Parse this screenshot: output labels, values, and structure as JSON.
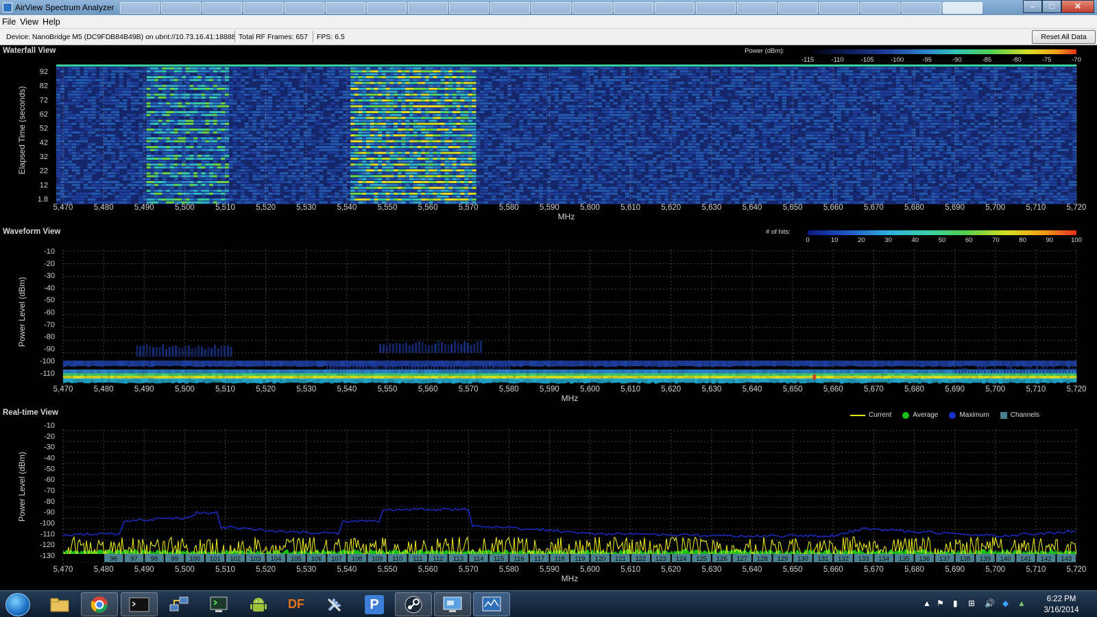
{
  "window": {
    "title": "AirView Spectrum Analyzer",
    "controls": {
      "minimize": "–",
      "maximize": "□",
      "close": "✕"
    }
  },
  "menu": [
    "File",
    "View",
    "Help"
  ],
  "status": {
    "device": "Device: NanoBridge M5 (DC9FDB84B49B) on ubnt://10.73.16.41:18888",
    "frames": "Total RF Frames: 657",
    "fps": "FPS: 6.5",
    "reset_label": "Reset All Data"
  },
  "x_axis": {
    "label": "MHz",
    "ticks": [
      "5,470",
      "5,480",
      "5,490",
      "5,500",
      "5,510",
      "5,520",
      "5,530",
      "5,540",
      "5,550",
      "5,560",
      "5,570",
      "5,580",
      "5,590",
      "5,600",
      "5,610",
      "5,620",
      "5,630",
      "5,640",
      "5,650",
      "5,660",
      "5,670",
      "5,680",
      "5,690",
      "5,700",
      "5,710",
      "5,720"
    ]
  },
  "waterfall": {
    "title": "Waterfall View",
    "ylabel": "Elapsed Time (seconds)",
    "yticks": [
      "92",
      "82",
      "72",
      "62",
      "52",
      "42",
      "32",
      "22",
      "12",
      "1.8"
    ],
    "legend_caption": "Power (dBm):",
    "legend_ticks": [
      "-115",
      "-110",
      "-105",
      "-100",
      "-95",
      "-90",
      "-85",
      "-80",
      "-75",
      "-70"
    ]
  },
  "waveform": {
    "title": "Waveform View",
    "ylabel": "Power Level (dBm)",
    "yticks": [
      "-10",
      "-20",
      "-30",
      "-40",
      "-50",
      "-60",
      "-70",
      "-80",
      "-90",
      "-100",
      "-110"
    ],
    "legend_caption": "# of hits:",
    "legend_ticks": [
      "0",
      "10",
      "20",
      "30",
      "40",
      "50",
      "60",
      "70",
      "80",
      "90",
      "100"
    ]
  },
  "realtime": {
    "title": "Real-time View",
    "ylabel": "Power Level (dBm)",
    "yticks": [
      "-10",
      "-20",
      "-30",
      "-40",
      "-50",
      "-60",
      "-70",
      "-80",
      "-90",
      "-100",
      "-110",
      "-120",
      "-130"
    ],
    "legend": [
      {
        "label": "Current",
        "color": "#e6e61e"
      },
      {
        "label": "Average",
        "color": "#18c018"
      },
      {
        "label": "Maximum",
        "color": "#1a2fd0"
      },
      {
        "label": "Channels",
        "color": "#4a7f8f"
      }
    ],
    "channels": [
      "96",
      "97",
      "98",
      "99",
      "100",
      "101",
      "102",
      "103",
      "104",
      "105",
      "106",
      "107",
      "108",
      "109",
      "110",
      "111",
      "112",
      "113",
      "114",
      "115",
      "116",
      "117",
      "118",
      "119",
      "120",
      "121",
      "122",
      "123",
      "124",
      "125",
      "126",
      "127",
      "128",
      "129",
      "130",
      "131",
      "132",
      "133",
      "134",
      "135",
      "136",
      "137",
      "138",
      "139",
      "140",
      "141",
      "142",
      "143"
    ]
  },
  "chart_data": [
    {
      "type": "heatmap",
      "title": "Waterfall View",
      "xlabel": "MHz",
      "ylabel": "Elapsed Time (seconds)",
      "xlim": [
        5470,
        5720
      ],
      "ylim": [
        1.8,
        92
      ],
      "value_label": "Power (dBm)",
      "colorbar_range": [
        -115,
        -70
      ],
      "hot_bands_mhz": [
        [
          5490,
          5510
        ],
        [
          5540,
          5570
        ]
      ]
    },
    {
      "type": "heatmap",
      "title": "Waveform View",
      "xlabel": "MHz",
      "ylabel": "Power Level (dBm)",
      "xlim": [
        5470,
        5720
      ],
      "ylim": [
        -110,
        -10
      ],
      "value_label": "# of hits",
      "colorbar_range": [
        0,
        100
      ]
    },
    {
      "type": "line",
      "title": "Real-time View",
      "xlabel": "MHz",
      "ylabel": "Power Level (dBm)",
      "xlim": [
        5470,
        5720
      ],
      "ylim": [
        -130,
        -10
      ],
      "series": [
        {
          "name": "Maximum",
          "x": [
            5470,
            5484,
            5485,
            5500,
            5503,
            5508,
            5509,
            5520,
            5530,
            5538,
            5539,
            5548,
            5549,
            5562,
            5570,
            5571,
            5590,
            5600,
            5640,
            5660,
            5668,
            5675,
            5690,
            5700,
            5720
          ],
          "y": [
            -105,
            -104,
            -92,
            -90,
            -85,
            -85,
            -98,
            -101,
            -103,
            -104,
            -93,
            -92,
            -82,
            -82,
            -82,
            -97,
            -101,
            -104,
            -106,
            -106,
            -99,
            -101,
            -104,
            -106,
            -102
          ]
        },
        {
          "name": "Average",
          "x": [
            5470,
            5720
          ],
          "y": [
            -120,
            -120
          ]
        },
        {
          "name": "Current",
          "x": [
            5470,
            5720
          ],
          "y": [
            -118,
            -118
          ]
        }
      ]
    }
  ],
  "taskbar": {
    "clock_time": "6:22 PM",
    "clock_date": "3/16/2014",
    "apps": [
      "folder-icon",
      "chrome-icon",
      "terminal-icon",
      "network-icon",
      "monitor-icon",
      "android-icon",
      "df-icon",
      "tools-icon",
      "p-icon",
      "steam-icon",
      "remote-desktop-icon",
      "airview-icon"
    ],
    "df_label": "DF",
    "p_label": "P"
  }
}
